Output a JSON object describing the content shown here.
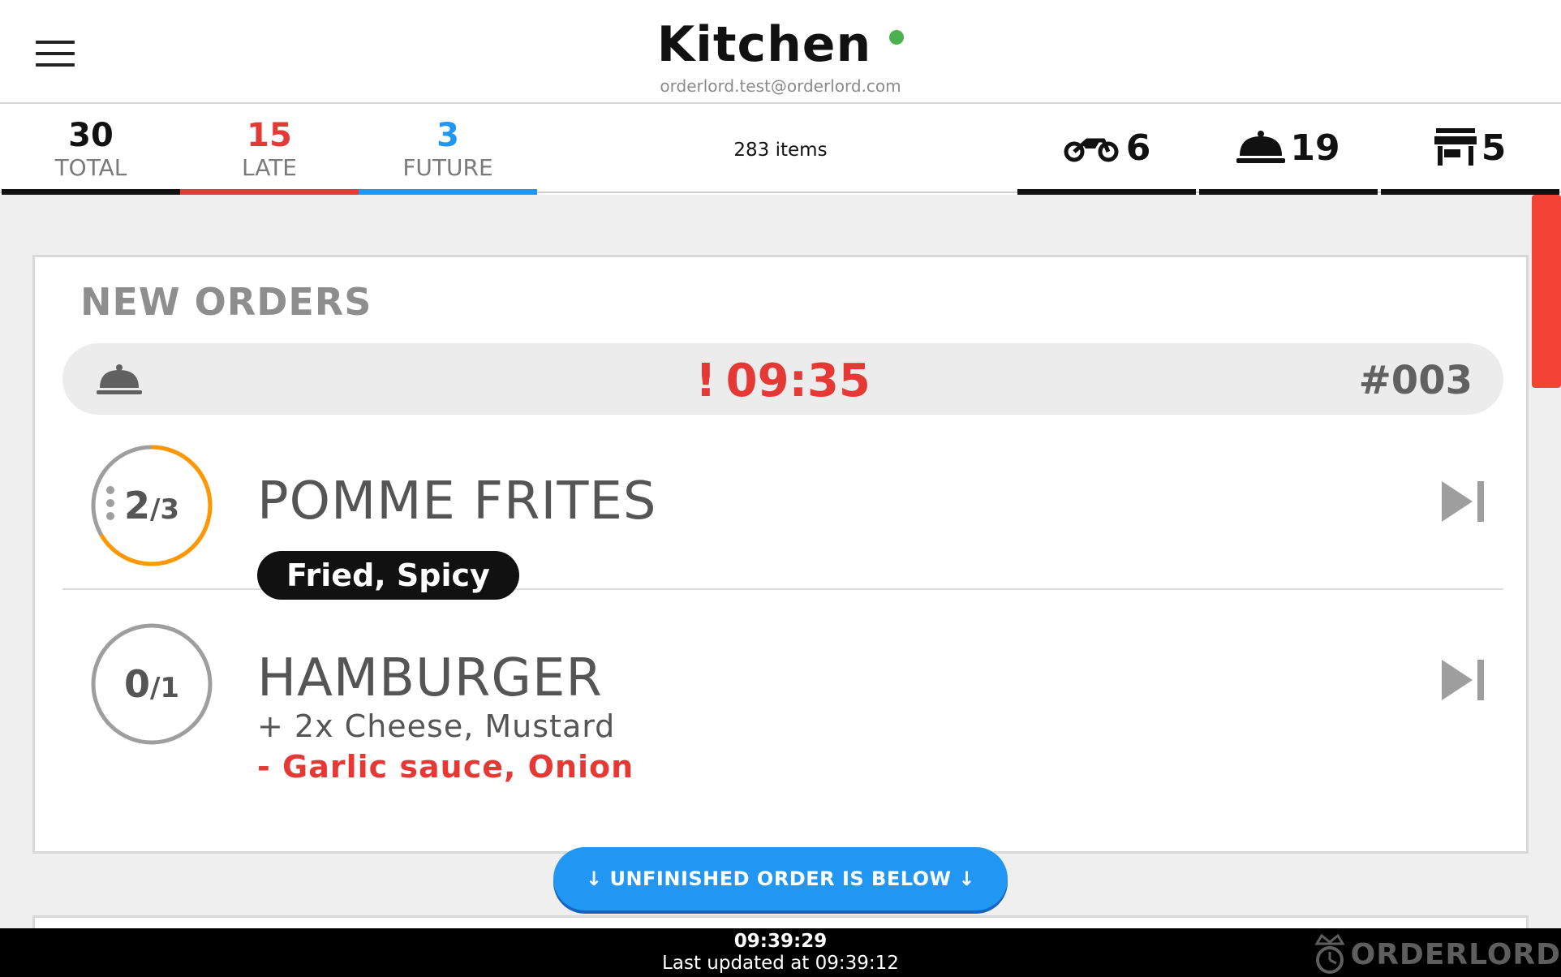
{
  "header": {
    "title": "Kitchen",
    "account": "orderlord.test@orderlord.com",
    "status_color": "#4caf50"
  },
  "stats": {
    "total": {
      "value": "30",
      "label": "TOTAL",
      "color": "#111111"
    },
    "late": {
      "value": "15",
      "label": "LATE",
      "color": "#e53935"
    },
    "future": {
      "value": "3",
      "label": "FUTURE",
      "color": "#2196f3"
    },
    "items": "283 items",
    "delivery": {
      "icon": "motorbike-icon",
      "count": "6"
    },
    "dine_in": {
      "icon": "cloche-icon",
      "count": "19"
    },
    "takeaway": {
      "icon": "store-icon",
      "count": "5"
    }
  },
  "section": {
    "title": "NEW ORDERS"
  },
  "order": {
    "type_icon": "cloche-icon",
    "warning": "!",
    "time": "09:35",
    "number": "#003",
    "items": [
      {
        "done": "2",
        "total": "/3",
        "progress": 0.6667,
        "progress_color": "#ff9800",
        "name": "POMME FRITES",
        "tag": "Fried, Spicy"
      },
      {
        "done": "0",
        "total": "/1",
        "progress": 0,
        "name": "HAMBURGER",
        "add": "+ 2x Cheese, Mustard",
        "remove": "- Garlic sauce, Onion"
      }
    ]
  },
  "notice": {
    "label": "↓  UNFINISHED ORDER IS BELOW  ↓"
  },
  "footer": {
    "clock": "09:39:29",
    "updated": "Last updated at 09:39:12",
    "brand": "ORDERLORD"
  }
}
